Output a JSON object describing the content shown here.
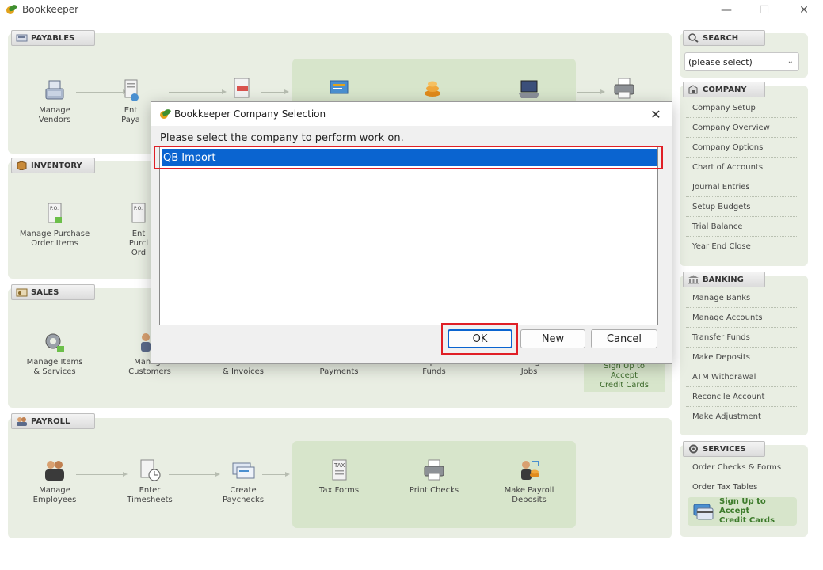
{
  "window": {
    "title": "Bookkeeper",
    "minimize": "—",
    "maximize": "☐",
    "close": "✕"
  },
  "search": {
    "tab": "SEARCH",
    "select_value": "(please select)"
  },
  "payables": {
    "tab": "PAYABLES",
    "items": [
      {
        "label": "Manage\nVendors"
      },
      {
        "label": "Ent\nPaya"
      }
    ]
  },
  "inventory": {
    "tab": "INVENTORY",
    "items": [
      {
        "label": "Manage Purchase\nOrder Items"
      },
      {
        "label": "Ent\nPurcl\nOrd"
      }
    ]
  },
  "sales": {
    "tab": "SALES",
    "items": [
      {
        "label": "Manage Items\n& Services"
      },
      {
        "label": "Manage\nCustomers"
      },
      {
        "label": "Estimates\n& Invoices"
      },
      {
        "label": "Receive\nPayments"
      },
      {
        "label": "Undeposited\nFunds"
      },
      {
        "label": "Manage\nJobs"
      }
    ],
    "promo": "Sign Up to\nAccept\nCredit Cards"
  },
  "payroll": {
    "tab": "PAYROLL",
    "items": [
      {
        "label": "Manage\nEmployees"
      },
      {
        "label": "Enter\nTimesheets"
      },
      {
        "label": "Create\nPaychecks"
      },
      {
        "label": "Tax Forms"
      },
      {
        "label": "Print Checks"
      },
      {
        "label": "Make Payroll\nDeposits"
      }
    ]
  },
  "company": {
    "tab": "COMPANY",
    "items": [
      "Company Setup",
      "Company Overview",
      "Company Options",
      "Chart of Accounts",
      "Journal Entries",
      "Setup Budgets",
      "Trial Balance",
      "Year End Close"
    ]
  },
  "banking": {
    "tab": "BANKING",
    "items": [
      "Manage Banks",
      "Manage Accounts",
      "Transfer Funds",
      "Make Deposits",
      "ATM Withdrawal",
      "Reconcile Account",
      "Make Adjustment"
    ]
  },
  "services": {
    "tab": "SERVICES",
    "items": [
      "Order Checks & Forms",
      "Order Tax Tables"
    ],
    "promo": "Sign Up to Accept\nCredit Cards"
  },
  "dialog": {
    "title": "Bookkeeper Company Selection",
    "prompt": "Please select the company to perform work on.",
    "companies": [
      "QB Import"
    ],
    "ok_label": "OK",
    "new_label": "New",
    "cancel_label": "Cancel",
    "close": "✕"
  },
  "colors": {
    "panel": "#e9eee3",
    "subpanel": "#d7e5cb",
    "selection": "#0a64d0",
    "highlight": "#e01f26"
  }
}
